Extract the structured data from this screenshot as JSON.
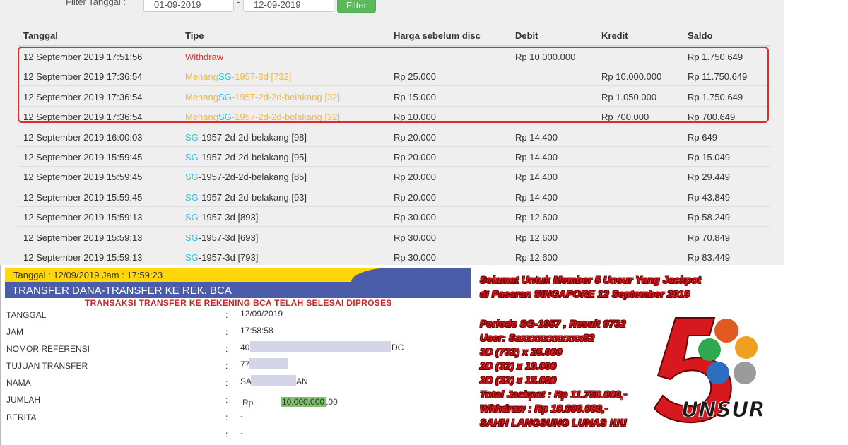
{
  "filter": {
    "label": "Filter Tanggal :",
    "date_from": "01-09-2019",
    "separator": "-",
    "date_to": "12-09-2019",
    "button": "Filter"
  },
  "table": {
    "headers": [
      "Tanggal",
      "Tipe",
      "Harga sebelum disc",
      "Debit",
      "Kredit",
      "Saldo"
    ],
    "rows": [
      {
        "date": "12 September 2019 17:51:56",
        "prefix": "Withdraw",
        "sg": "",
        "rest": "",
        "harga": "",
        "debit": "Rp 10.000.000",
        "kredit": "",
        "saldo": "Rp 1.750.649"
      },
      {
        "date": "12 September 2019 17:36:54",
        "prefix": "Menang",
        "sg": "SG",
        "rest": "-1957-3d [732]",
        "harga": "Rp 25.000",
        "debit": "",
        "kredit": "Rp 10.000.000",
        "saldo": "Rp 11.750.649"
      },
      {
        "date": "12 September 2019 17:36:54",
        "prefix": "Menang",
        "sg": "SG",
        "rest": "-1957-2d-2d-belakang [32]",
        "harga": "Rp 15.000",
        "debit": "",
        "kredit": "Rp 1.050.000",
        "saldo": "Rp 1.750.649"
      },
      {
        "date": "12 September 2019 17:36:54",
        "prefix": "Menang",
        "sg": "SG",
        "rest": "-1957-2d-2d-belakang [32]",
        "harga": "Rp 10.000",
        "debit": "",
        "kredit": "Rp 700.000",
        "saldo": "Rp 700.649"
      },
      {
        "date": "12 September 2019 16:00:03",
        "prefix": "",
        "sg": "SG",
        "rest": "-1957-2d-2d-belakang [98]",
        "harga": "Rp 20.000",
        "debit": "Rp 14.400",
        "kredit": "",
        "saldo": "Rp 649"
      },
      {
        "date": "12 September 2019 15:59:45",
        "prefix": "",
        "sg": "SG",
        "rest": "-1957-2d-2d-belakang [95]",
        "harga": "Rp 20.000",
        "debit": "Rp 14.400",
        "kredit": "",
        "saldo": "Rp 15.049"
      },
      {
        "date": "12 September 2019 15:59:45",
        "prefix": "",
        "sg": "SG",
        "rest": "-1957-2d-2d-belakang [85]",
        "harga": "Rp 20.000",
        "debit": "Rp 14.400",
        "kredit": "",
        "saldo": "Rp 29.449"
      },
      {
        "date": "12 September 2019 15:59:45",
        "prefix": "",
        "sg": "SG",
        "rest": "-1957-2d-2d-belakang [93]",
        "harga": "Rp 20.000",
        "debit": "Rp 14.400",
        "kredit": "",
        "saldo": "Rp 43.849"
      },
      {
        "date": "12 September 2019 15:59:13",
        "prefix": "",
        "sg": "SG",
        "rest": "-1957-3d [893]",
        "harga": "Rp 30.000",
        "debit": "Rp 12.600",
        "kredit": "",
        "saldo": "Rp 58.249"
      },
      {
        "date": "12 September 2019 15:59:13",
        "prefix": "",
        "sg": "SG",
        "rest": "-1957-3d [693]",
        "harga": "Rp 30.000",
        "debit": "Rp 12.600",
        "kredit": "",
        "saldo": "Rp 70.849"
      },
      {
        "date": "12 September 2019 15:59:13",
        "prefix": "",
        "sg": "SG",
        "rest": "-1957-3d [793]",
        "harga": "Rp 30.000",
        "debit": "Rp 12.600",
        "kredit": "",
        "saldo": "Rp 83.449"
      }
    ]
  },
  "receipt": {
    "header": "Tanggal : 12/09/2019 Jam : 17:59:23",
    "title": "TRANSFER DANA-TRANSFER KE REK. BCA",
    "status": "TRANSAKSI TRANSFER KE REKENING BCA TELAH SELESAI DIPROSES",
    "fields": [
      {
        "label": "TANGGAL",
        "value": "12/09/2019"
      },
      {
        "label": "JAM",
        "value": "17:58:58"
      },
      {
        "label": "NOMOR REFERENSI",
        "value_start": "40",
        "value_end": "DC"
      },
      {
        "label": "TUJUAN TRANSFER",
        "value_start": "77",
        "value_end": ""
      },
      {
        "label": "NAMA",
        "value_start": "SA",
        "value_end": "AN"
      },
      {
        "label": "JUMLAH",
        "currency": "Rp.",
        "amount": "10.000.000",
        "cents": ",00"
      },
      {
        "label": "BERITA",
        "value": "-",
        "value2": "-"
      }
    ],
    "colon": ":"
  },
  "promo": {
    "lines": [
      "Selamat Untuk Member 5 Unsur Yang Jackpot",
      "di Pasaran SINGAPORE 12 September 2019",
      "Periode SG-1957 , Result 0732",
      "User: Saxxxxxxxxxxx82",
      "3D (732) x 25.000",
      "2D (32) x 10.000",
      "2D (32) x 15.000",
      "Total Jackpot : Rp 11.750.000,-",
      "Withdraw : Rp 10.000.000,-",
      "SAHH LANGSUNG LUNAS !!!!!"
    ],
    "logo_text": "UNSUR",
    "logo_number": "5",
    "colors": {
      "red": "#d7181e",
      "green": "#2fa84f",
      "blue": "#2a6fc0",
      "orange": "#f0a020"
    }
  }
}
